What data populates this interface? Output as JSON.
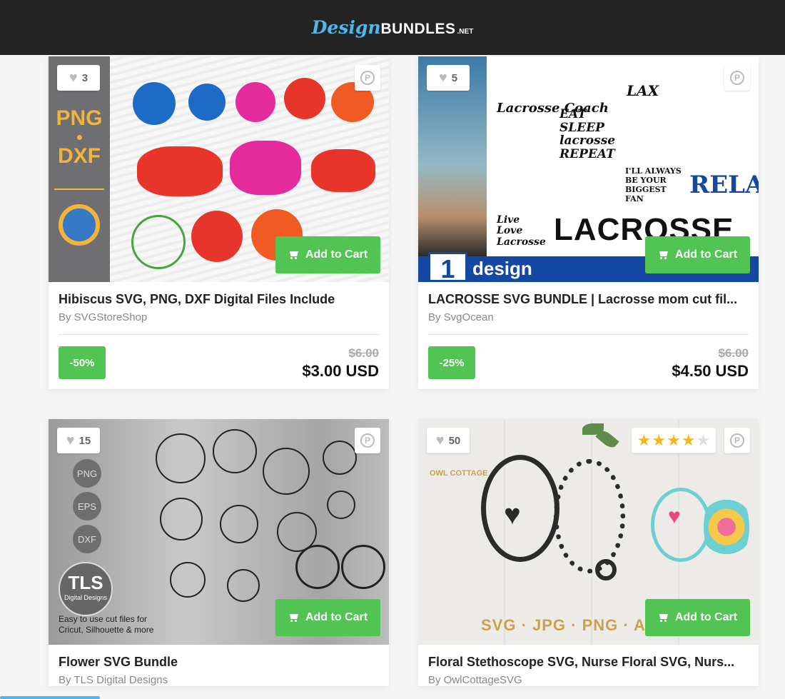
{
  "header": {
    "logo_design": "Design",
    "logo_bundles": "BUNDLES",
    "logo_net": ".NET"
  },
  "add_to_cart_label": "Add to Cart",
  "products": [
    {
      "likes": "3",
      "title": "Hibiscus SVG, PNG, DXF Digital Files Include",
      "author": "By SVGStoreShop",
      "discount": "-50%",
      "old_price": "$6.00",
      "price": "$3.00 USD",
      "thumb_text": [
        "PNG",
        "DXF"
      ]
    },
    {
      "likes": "5",
      "title": "LACROSSE SVG BUNDLE | Lacrosse mom cut fil...",
      "author": "By SvgOcean",
      "discount": "-25%",
      "old_price": "$6.00",
      "price": "$4.50 USD",
      "thumb_text": [
        "1",
        "design",
        "LACROSSE",
        "Lacrosse Coach",
        "EAT SLEEP lacrosse REPEAT",
        "LAX",
        "Live Love Lacrosse",
        "RELAX",
        "I'LL ALWAYS BE YOUR BIGGEST FAN"
      ]
    },
    {
      "likes": "15",
      "title": "Flower SVG Bundle",
      "author": "By TLS Digital Designs",
      "thumb_text": [
        "PNG",
        "EPS",
        "DXF",
        "TLS",
        "Digital Designs",
        "Easy to use cut files for",
        "Cricut, Silhouette & more"
      ]
    },
    {
      "likes": "50",
      "title": "Floral Stethoscope SVG, Nurse Floral SVG, Nurs...",
      "author": "By OwlCottageSVG",
      "rating": 4,
      "thumb_text": [
        "OWL COTTAGE",
        "SVG · JPG · PNG · Ai · EPS"
      ]
    }
  ],
  "colors": {
    "accent_green": "#51c454",
    "brand_blue": "#4bb8ef",
    "header_bg": "#232323"
  },
  "icons": {
    "like": "heart-icon",
    "pin": "pinterest-icon",
    "cart": "cart-icon",
    "star": "star-icon"
  }
}
